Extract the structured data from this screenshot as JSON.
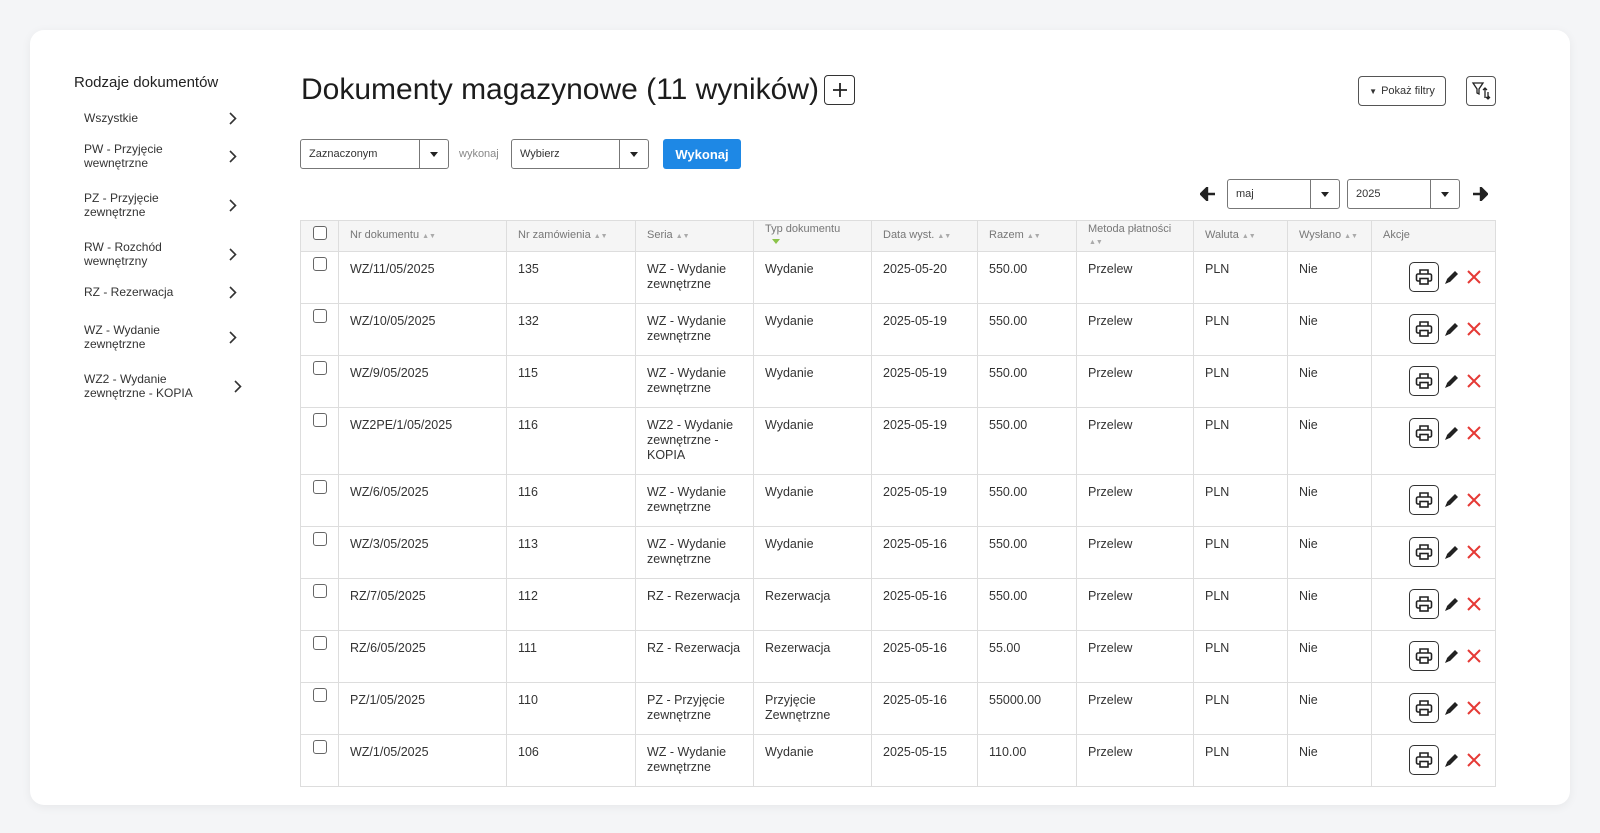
{
  "sidebar": {
    "title": "Rodzaje dokumentów",
    "items": [
      {
        "label": "Wszystkie"
      },
      {
        "label": "PW - Przyjęcie wewnętrzne"
      },
      {
        "label": "PZ - Przyjęcie zewnętrzne"
      },
      {
        "label": "RW - Rozchód wewnętrzny"
      },
      {
        "label": "RZ - Rezerwacja"
      },
      {
        "label": "WZ - Wydanie zewnętrzne"
      },
      {
        "label": "WZ2 - Wydanie zewnętrzne - KOPIA"
      }
    ]
  },
  "header": {
    "title": "Dokumenty magazynowe (11 wyników)",
    "show_filters_label": "Pokaż filtry"
  },
  "toolbar": {
    "scope_value": "Zaznaczonym",
    "action_prefix": "wykonaj",
    "action_value": "Wybierz",
    "execute_label": "Wykonaj"
  },
  "period": {
    "month": "maj",
    "year": "2025"
  },
  "table": {
    "columns": [
      "Nr dokumentu",
      "Nr zamówienia",
      "Seria",
      "Typ dokumentu",
      "Data wyst.",
      "Razem",
      "Metoda płatności",
      "Waluta",
      "Wysłano",
      "Akcje"
    ],
    "rows": [
      {
        "nr": "WZ/11/05/2025",
        "order": "135",
        "series": "WZ - Wydanie zewnętrzne",
        "type": "Wydanie",
        "date": "2025-05-20",
        "total": "550.00",
        "payment": "Przelew",
        "currency": "PLN",
        "sent": "Nie"
      },
      {
        "nr": "WZ/10/05/2025",
        "order": "132",
        "series": "WZ - Wydanie zewnętrzne",
        "type": "Wydanie",
        "date": "2025-05-19",
        "total": "550.00",
        "payment": "Przelew",
        "currency": "PLN",
        "sent": "Nie"
      },
      {
        "nr": "WZ/9/05/2025",
        "order": "115",
        "series": "WZ - Wydanie zewnętrzne",
        "type": "Wydanie",
        "date": "2025-05-19",
        "total": "550.00",
        "payment": "Przelew",
        "currency": "PLN",
        "sent": "Nie"
      },
      {
        "nr": "WZ2PE/1/05/2025",
        "order": "116",
        "series": "WZ2 - Wydanie zewnętrzne - KOPIA",
        "type": "Wydanie",
        "date": "2025-05-19",
        "total": "550.00",
        "payment": "Przelew",
        "currency": "PLN",
        "sent": "Nie"
      },
      {
        "nr": "WZ/6/05/2025",
        "order": "116",
        "series": "WZ - Wydanie zewnętrzne",
        "type": "Wydanie",
        "date": "2025-05-19",
        "total": "550.00",
        "payment": "Przelew",
        "currency": "PLN",
        "sent": "Nie"
      },
      {
        "nr": "WZ/3/05/2025",
        "order": "113",
        "series": "WZ - Wydanie zewnętrzne",
        "type": "Wydanie",
        "date": "2025-05-16",
        "total": "550.00",
        "payment": "Przelew",
        "currency": "PLN",
        "sent": "Nie"
      },
      {
        "nr": "RZ/7/05/2025",
        "order": "112",
        "series": "RZ - Rezerwacja",
        "type": "Rezerwacja",
        "date": "2025-05-16",
        "total": "550.00",
        "payment": "Przelew",
        "currency": "PLN",
        "sent": "Nie"
      },
      {
        "nr": "RZ/6/05/2025",
        "order": "111",
        "series": "RZ - Rezerwacja",
        "type": "Rezerwacja",
        "date": "2025-05-16",
        "total": "55.00",
        "payment": "Przelew",
        "currency": "PLN",
        "sent": "Nie"
      },
      {
        "nr": "PZ/1/05/2025",
        "order": "110",
        "series": "PZ - Przyjęcie zewnętrzne",
        "type": "Przyjęcie Zewnętrzne",
        "date": "2025-05-16",
        "total": "55000.00",
        "payment": "Przelew",
        "currency": "PLN",
        "sent": "Nie"
      },
      {
        "nr": "WZ/1/05/2025",
        "order": "106",
        "series": "WZ - Wydanie zewnętrzne",
        "type": "Wydanie",
        "date": "2025-05-15",
        "total": "110.00",
        "payment": "Przelew",
        "currency": "PLN",
        "sent": "Nie"
      }
    ]
  },
  "icons": {
    "add": "plus-icon",
    "sort_filter": "filter-sort-icon",
    "prev": "arrow-left-icon",
    "next": "arrow-right-icon",
    "print": "printer-icon",
    "edit": "pencil-icon",
    "delete": "close-icon"
  },
  "colors": {
    "accent": "#1e88e5",
    "delete": "#e53935",
    "sort_active": "#8bc34a"
  }
}
